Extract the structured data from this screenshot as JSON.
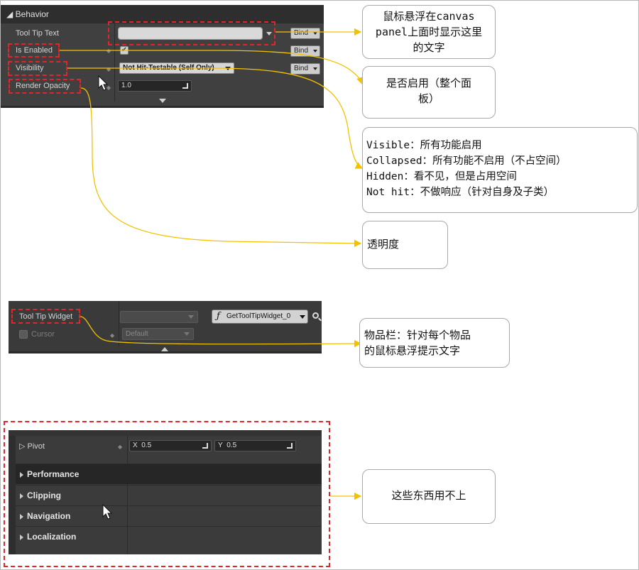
{
  "behavior_panel": {
    "header": "Behavior",
    "rows": {
      "tool_tip_text": "Tool Tip Text",
      "is_enabled": "Is Enabled",
      "visibility": "Visibility",
      "render_opacity": "Render Opacity"
    },
    "bind_label": "Bind",
    "visibility_value": "Not Hit-Testable (Self Only)",
    "opacity_value": "1.0",
    "checkbox_mark": "✔"
  },
  "tooltip_panel": {
    "tool_tip_widget_label": "Tool Tip Widget",
    "cursor_label": "Cursor",
    "cursor_value": "Default",
    "function_label": "GetToolTipWidget_0",
    "function_icon": "ƒ"
  },
  "bottom_panel": {
    "pivot_label": "Pivot",
    "pivot_x_label": "X",
    "pivot_x_value": "0.5",
    "pivot_y_label": "Y",
    "pivot_y_value": "0.5",
    "sections": [
      "Performance",
      "Clipping",
      "Navigation",
      "Localization"
    ]
  },
  "annotations": {
    "tooltip_note": "鼠标悬浮在canvas\npanel上面时显示这里\n的文字",
    "enabled_note": "是否启用（整个面\n板）",
    "visibility_note": "Visible：所有功能启用\nCollapsed：所有功能不启用（不占空间）\nHidden：看不见，但是占用空间\nNot hit：不做响应（针对自身及子类）",
    "opacity_note": "透明度",
    "widget_note": "物品栏：针对每个物品\n的鼠标悬浮提示文字",
    "unused_note": "这些东西用不上"
  },
  "colors": {
    "accent_red": "#e0262b",
    "connector_yellow": "#f2c200",
    "panel_dark": "#3c3c3c"
  }
}
